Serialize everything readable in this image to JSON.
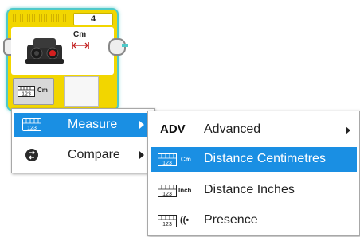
{
  "block": {
    "port_number": "4",
    "unit_label": "Cm",
    "mode_unit_short": "Cm",
    "measure_icon_digits": "123",
    "accent_color": "#f2d600",
    "outline_color": "#4fc9c9"
  },
  "menu_primary": {
    "items": [
      {
        "label": "Measure",
        "icon": "measure-grid-icon",
        "has_submenu": true,
        "active": true
      },
      {
        "label": "Compare",
        "icon": "compare-icon",
        "has_submenu": true,
        "active": false
      }
    ]
  },
  "menu_secondary": {
    "items": [
      {
        "prefix": "ADV",
        "label": "Advanced",
        "has_submenu": true,
        "active": false
      },
      {
        "prefix": "Cm",
        "label": "Distance Centimetres",
        "active": true
      },
      {
        "prefix": "Inch",
        "label": "Distance Inches",
        "active": false
      },
      {
        "prefix": "((•",
        "label": "Presence",
        "active": false
      }
    ]
  },
  "colors": {
    "highlight": "#1a8fe3",
    "menu_border": "#a8a8a8"
  }
}
